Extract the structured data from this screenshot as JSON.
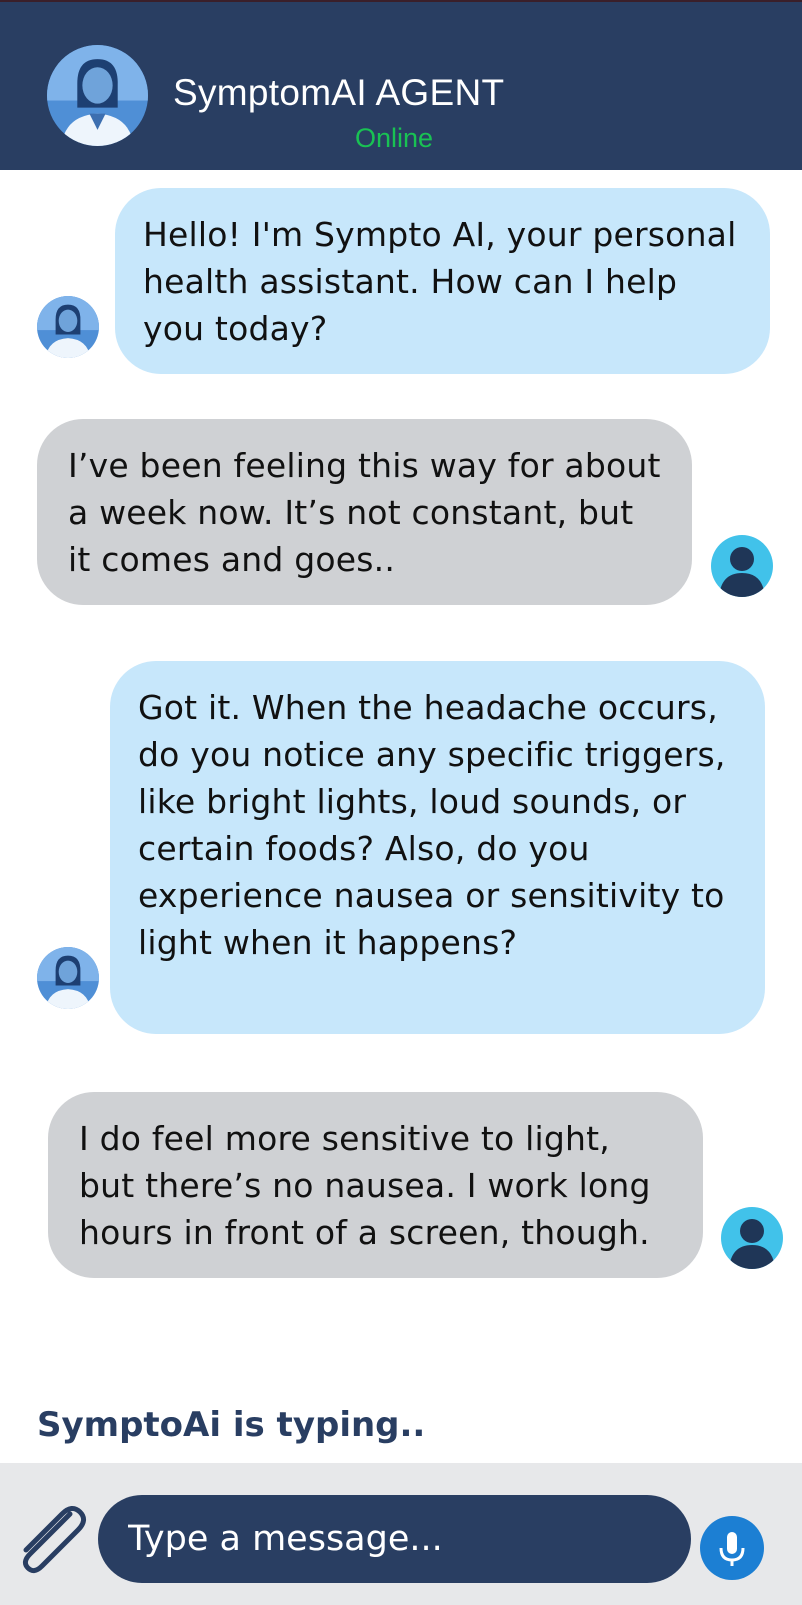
{
  "header": {
    "title": "SymptomAI AGENT",
    "status": "Online",
    "status_color": "#19c253",
    "background": "#293e62"
  },
  "messages": [
    {
      "sender": "bot",
      "text": "Hello! I'm Sympto AI, your personal health assistant. How can I help you today?"
    },
    {
      "sender": "user",
      "text": "I’ve been feeling this way for about a week now. It’s not constant, but it comes and goes.."
    },
    {
      "sender": "bot",
      "text": "Got it. When the headache occurs, do you notice any specific triggers, like bright lights, loud sounds, or certain foods? Also, do you experience nausea or sensitivity to light when it happens?"
    },
    {
      "sender": "user",
      "text": "I do feel more sensitive to light, but there’s no nausea. I work long hours in front of a screen, though."
    }
  ],
  "typing_indicator": "SymptoAi is typing..",
  "composer": {
    "placeholder": "Type a message...",
    "attach_icon": "paperclip-icon",
    "mic_icon": "microphone-icon"
  },
  "colors": {
    "bot_bubble": "#c7e7fb",
    "user_bubble": "#cfd1d4",
    "user_avatar": "#41c2ea",
    "mic_button": "#1c7fd3"
  }
}
